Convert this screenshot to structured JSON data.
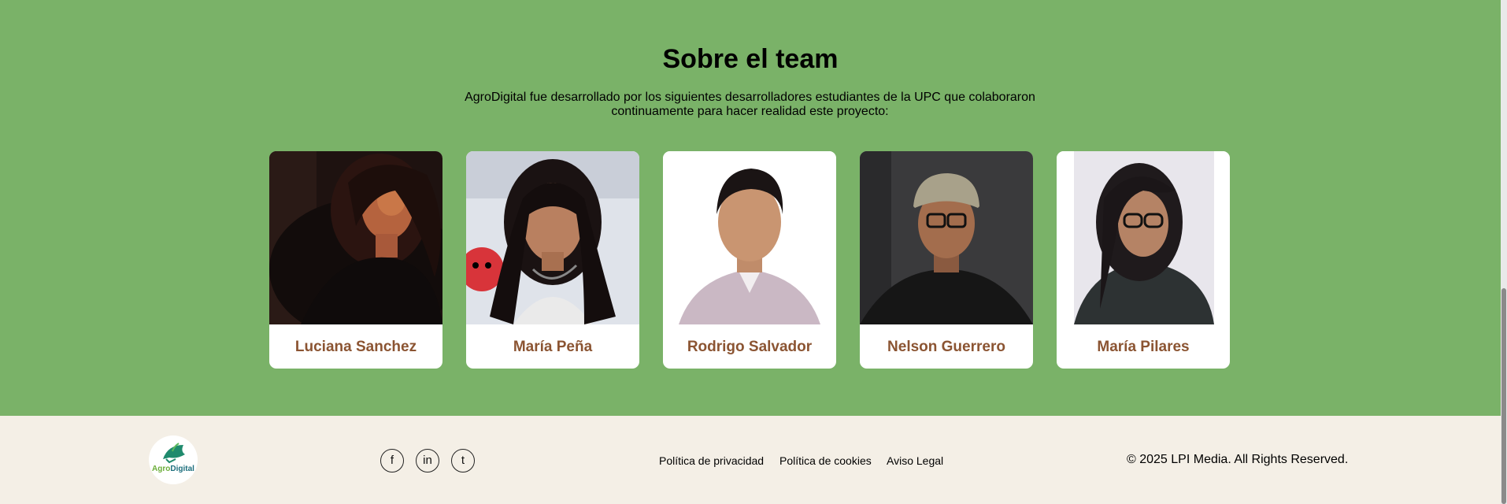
{
  "team": {
    "title": "Sobre el team",
    "description": "AgroDigital fue desarrollado por los siguientes desarrolladores estudiantes de la UPC que colaboraron continuamente para hacer realidad este proyecto:",
    "members": [
      {
        "name": "Luciana Sanchez"
      },
      {
        "name": "María Peña"
      },
      {
        "name": "Rodrigo Salvador"
      },
      {
        "name": "Nelson Guerrero"
      },
      {
        "name": "María Pilares"
      }
    ]
  },
  "footer": {
    "logo": {
      "agro": "Agro",
      "digital": "Digital"
    },
    "social": [
      {
        "icon": "facebook-icon",
        "glyph": "f"
      },
      {
        "icon": "linkedin-icon",
        "glyph": "in"
      },
      {
        "icon": "twitter-icon",
        "glyph": "t"
      }
    ],
    "links": [
      "Política de privacidad",
      "Política de cookies",
      "Aviso Legal"
    ],
    "copyright": "© 2025 LPI Media. All Rights Reserved."
  },
  "colors": {
    "section_background": "#7ab268",
    "footer_background": "#f4efe6",
    "member_name": "#8b5432"
  }
}
